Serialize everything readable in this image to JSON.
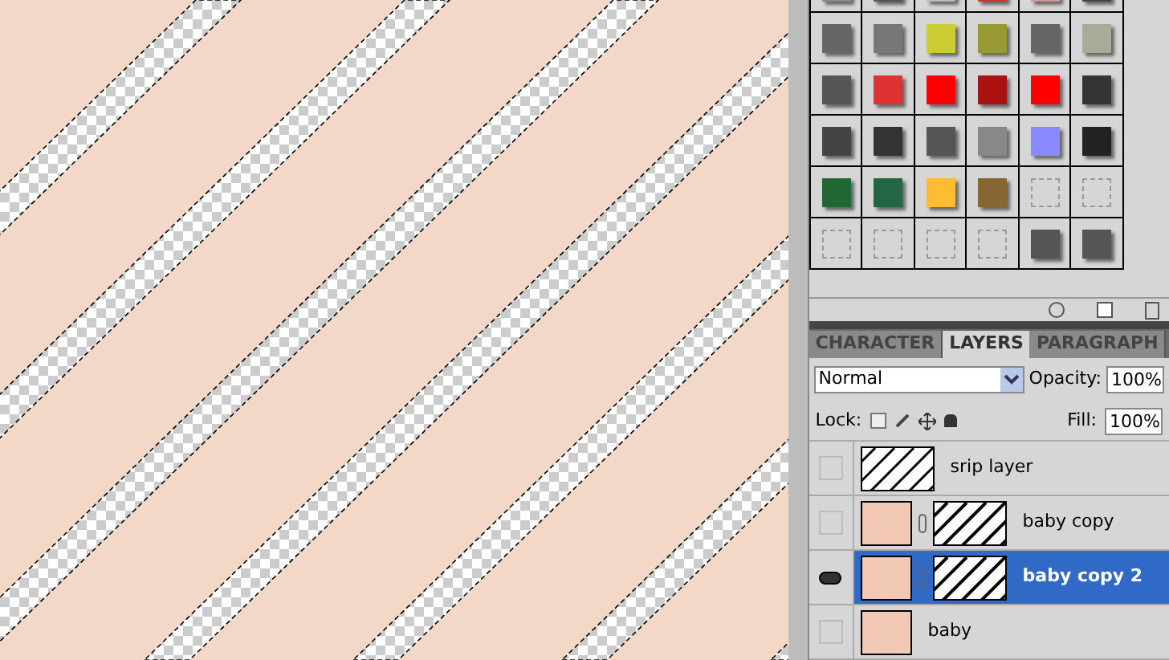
{
  "tabs": [
    {
      "label": "CHARACTER",
      "selected": false
    },
    {
      "label": "LAYERS",
      "selected": true
    },
    {
      "label": "PARAGRAPH",
      "selected": false
    }
  ],
  "blend_mode": {
    "value": "Normal"
  },
  "opacity": {
    "label": "Opacity:",
    "value": "100%"
  },
  "lock": {
    "label": "Lock:"
  },
  "fill": {
    "label": "Fill:",
    "value": "100%"
  },
  "layers": [
    {
      "name": "srip layer",
      "kind": "stripes",
      "visible": false,
      "selected": false
    },
    {
      "name": "baby  copy",
      "kind": "masked",
      "visible": false,
      "selected": false
    },
    {
      "name": "baby  copy 2",
      "kind": "masked",
      "visible": true,
      "selected": true
    },
    {
      "name": "baby",
      "kind": "photo",
      "visible": false,
      "selected": false
    }
  ]
}
